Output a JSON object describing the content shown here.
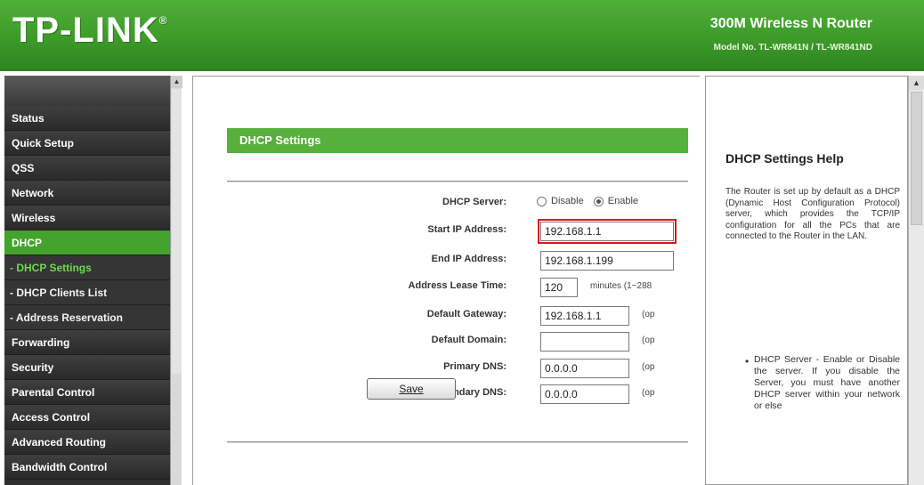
{
  "header": {
    "logo": "TP-LINK",
    "logo_mark": "®",
    "product_title": "300M Wireless N Router",
    "model_line": "Model No. TL-WR841N / TL-WR841ND"
  },
  "nav": {
    "items": [
      {
        "label": "Status"
      },
      {
        "label": "Quick Setup"
      },
      {
        "label": "QSS"
      },
      {
        "label": "Network"
      },
      {
        "label": "Wireless"
      },
      {
        "label": "DHCP"
      },
      {
        "label": "- DHCP Settings"
      },
      {
        "label": "- DHCP Clients List"
      },
      {
        "label": "- Address Reservation"
      },
      {
        "label": "Forwarding"
      },
      {
        "label": "Security"
      },
      {
        "label": "Parental Control"
      },
      {
        "label": "Access Control"
      },
      {
        "label": "Advanced Routing"
      },
      {
        "label": "Bandwidth Control"
      }
    ],
    "scroll_up": "▲"
  },
  "main": {
    "section_title": "DHCP Settings",
    "dhcp_server": {
      "label": "DHCP Server:",
      "option_disable": "Disable",
      "option_enable": "Enable"
    },
    "start_ip": {
      "label": "Start IP Address:",
      "value": "192.168.1.1"
    },
    "end_ip": {
      "label": "End IP Address:",
      "value": "192.168.1.199"
    },
    "lease_time": {
      "label": "Address Lease Time:",
      "value": "120",
      "note": "minutes (1~288"
    },
    "gateway": {
      "label": "Default Gateway:",
      "value": "192.168.1.1",
      "note": "(op"
    },
    "domain": {
      "label": "Default Domain:",
      "value": "",
      "note": "(op"
    },
    "primary_dns": {
      "label": "Primary DNS:",
      "value": "0.0.0.0",
      "note": "(op"
    },
    "secondary_dns": {
      "label": "Secondary DNS:",
      "value": "0.0.0.0",
      "note": "(op"
    },
    "save_label": "Save"
  },
  "help": {
    "title": "DHCP Settings Help",
    "intro": "The Router is set up by default as a DHCP (Dynamic Host Configuration Protocol) server, which provides the TCP/IP configuration for all the PCs that are connected to the Router in the LAN.",
    "bullet": "•",
    "item": "DHCP Server - Enable or Disable the server. If you disable the Server, you must have another DHCP server within your network or else",
    "scroll_up": "▲"
  }
}
